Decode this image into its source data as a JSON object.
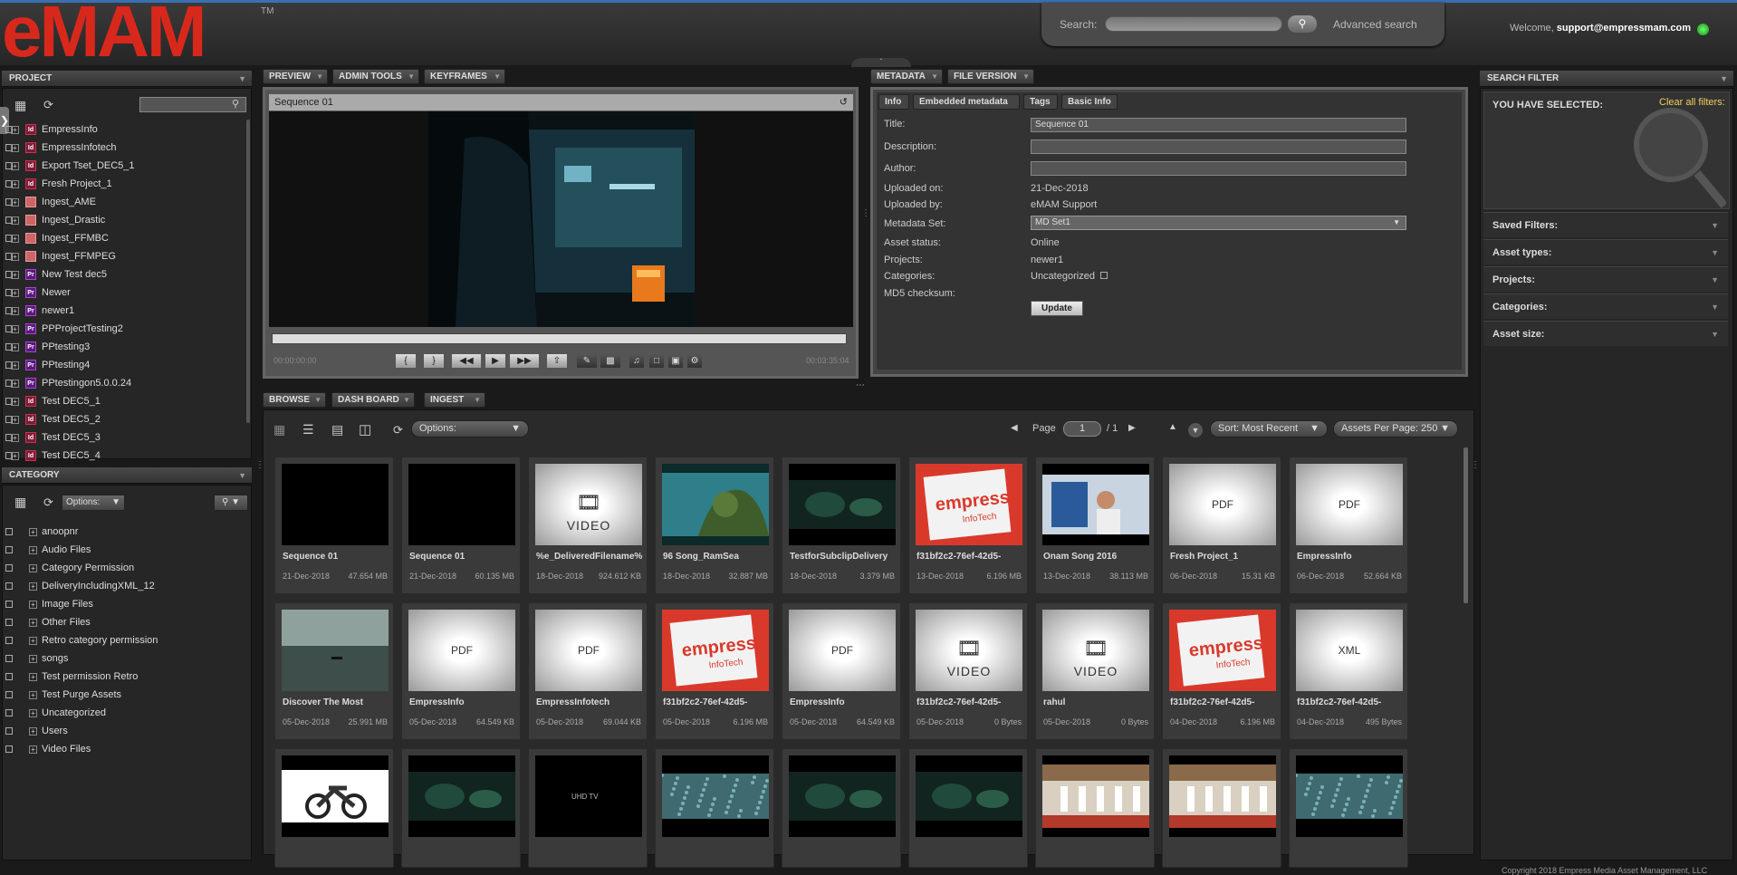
{
  "app": {
    "logo": "eMAM",
    "tm": "TM"
  },
  "header": {
    "search_label": "Search:",
    "search_value": "",
    "advanced": "Advanced search",
    "welcome_prefix": "Welcome,",
    "user": "support@empressmam.com"
  },
  "project_panel": {
    "title": "PROJECT",
    "items": [
      {
        "label": "EmpressInfo",
        "type": "Id"
      },
      {
        "label": "EmpressInfotech",
        "type": "Id"
      },
      {
        "label": "Export Tset_DEC5_1",
        "type": "Id"
      },
      {
        "label": "Fresh Project_1",
        "type": "Id"
      },
      {
        "label": "Ingest_AME",
        "type": "bin"
      },
      {
        "label": "Ingest_Drastic",
        "type": "bin"
      },
      {
        "label": "Ingest_FFMBC",
        "type": "bin"
      },
      {
        "label": "Ingest_FFMPEG",
        "type": "bin"
      },
      {
        "label": "New Test dec5",
        "type": "Pr"
      },
      {
        "label": "Newer",
        "type": "Pr"
      },
      {
        "label": "newer1",
        "type": "Pr"
      },
      {
        "label": "PPProjectTesting2",
        "type": "Pr"
      },
      {
        "label": "PPtesting3",
        "type": "Pr"
      },
      {
        "label": "PPtesting4",
        "type": "Pr"
      },
      {
        "label": "PPtestingon5.0.0.24",
        "type": "Pr"
      },
      {
        "label": "Test DEC5_1",
        "type": "Id"
      },
      {
        "label": "Test DEC5_2",
        "type": "Id"
      },
      {
        "label": "Test DEC5_3",
        "type": "Id"
      },
      {
        "label": "Test DEC5_4",
        "type": "Id"
      }
    ]
  },
  "category_panel": {
    "title": "CATEGORY",
    "options_label": "Options:",
    "items": [
      "anoopnr",
      "Audio Files",
      "Category Permission",
      "DeliveryIncludingXML_12",
      "Image Files",
      "Other Files",
      "Retro category permission",
      "songs",
      "Test permission Retro",
      "Test Purge Assets",
      "Uncategorized",
      "Users",
      "Video Files"
    ]
  },
  "preview_tabs": [
    "PREVIEW",
    "ADMIN TOOLS",
    "KEYFRAMES"
  ],
  "player": {
    "title": "Sequence 01",
    "time_start": "00:00:00:00",
    "time_end": "00:03:35:04"
  },
  "metadata_tabs": [
    "METADATA",
    "FILE VERSION"
  ],
  "meta_subtabs": [
    "Info",
    "Embedded metadata",
    "Tags",
    "Basic Info"
  ],
  "metadata": {
    "title_label": "Title:",
    "title_value": "Sequence 01",
    "desc_label": "Description:",
    "author_label": "Author:",
    "uploaded_on_label": "Uploaded on:",
    "uploaded_on": "21-Dec-2018",
    "uploaded_by_label": "Uploaded by:",
    "uploaded_by": "eMAM Support",
    "metaset_label": "Metadata Set:",
    "metaset": "MD Set1",
    "status_label": "Asset status:",
    "status": "Online",
    "projects_label": "Projects:",
    "projects": "newer1",
    "categories_label": "Categories:",
    "categories": "Uncategorized",
    "md5_label": "MD5 checksum:",
    "update_btn": "Update"
  },
  "search_filter": {
    "title": "SEARCH FILTER",
    "selected": "YOU HAVE SELECTED:",
    "clear": "Clear all filters:",
    "items": [
      "Saved Filters:",
      "Asset types:",
      "Projects:",
      "Categories:",
      "Asset size:"
    ]
  },
  "browse_tabs": [
    "BROWSE",
    "DASH BOARD",
    "INGEST"
  ],
  "browse_toolbar": {
    "options": "Options:",
    "page_label": "Page",
    "page": "1",
    "page_total": "/ 1",
    "sort": "Sort: Most Recent",
    "per_page": "Assets Per Page: 250"
  },
  "assets": [
    {
      "name": "Sequence 01",
      "date": "21-Dec-2018",
      "size": "47.654 MB",
      "thumb": "black"
    },
    {
      "name": "Sequence 01",
      "date": "21-Dec-2018",
      "size": "60.135 MB",
      "thumb": "black"
    },
    {
      "name": "%e_DeliveredFilename%",
      "date": "18-Dec-2018",
      "size": "924.612 KB",
      "thumb": "video"
    },
    {
      "name": "96 Song_RamSea",
      "date": "18-Dec-2018",
      "size": "32.887 MB",
      "thumb": "sea"
    },
    {
      "name": "TestforSubclipDelivery",
      "date": "18-Dec-2018",
      "size": "3.379 MB",
      "thumb": "dark"
    },
    {
      "name": "f31bf2c2-76ef-42d5-",
      "date": "13-Dec-2018",
      "size": "6.196 MB",
      "thumb": "empress"
    },
    {
      "name": "Onam Song 2016",
      "date": "13-Dec-2018",
      "size": "38.113 MB",
      "thumb": "onam"
    },
    {
      "name": "Fresh Project_1",
      "date": "06-Dec-2018",
      "size": "15.31 KB",
      "thumb": "pdf"
    },
    {
      "name": "EmpressInfo",
      "date": "06-Dec-2018",
      "size": "52.664 KB",
      "thumb": "pdf"
    },
    {
      "name": "Discover The Most",
      "date": "05-Dec-2018",
      "size": "25.991 MB",
      "thumb": "lake"
    },
    {
      "name": "EmpressInfo",
      "date": "05-Dec-2018",
      "size": "64.549 KB",
      "thumb": "pdf"
    },
    {
      "name": "EmpressInfotech",
      "date": "05-Dec-2018",
      "size": "69.044 KB",
      "thumb": "pdf"
    },
    {
      "name": "f31bf2c2-76ef-42d5-",
      "date": "05-Dec-2018",
      "size": "6.196 MB",
      "thumb": "empress"
    },
    {
      "name": "EmpressInfo",
      "date": "05-Dec-2018",
      "size": "64.549 KB",
      "thumb": "pdf"
    },
    {
      "name": "f31bf2c2-76ef-42d5-",
      "date": "05-Dec-2018",
      "size": "0 Bytes",
      "thumb": "video"
    },
    {
      "name": "rahul",
      "date": "05-Dec-2018",
      "size": "0 Bytes",
      "thumb": "video"
    },
    {
      "name": "f31bf2c2-76ef-42d5-",
      "date": "04-Dec-2018",
      "size": "6.196 MB",
      "thumb": "empress"
    },
    {
      "name": "f31bf2c2-76ef-42d5-",
      "date": "04-Dec-2018",
      "size": "495 Bytes",
      "thumb": "xml"
    },
    {
      "name": "",
      "date": "",
      "size": "",
      "thumb": "bike"
    },
    {
      "name": "",
      "date": "",
      "size": "",
      "thumb": "dark"
    },
    {
      "name": "",
      "date": "",
      "size": "",
      "thumb": "uhd"
    },
    {
      "name": "",
      "date": "",
      "size": "",
      "thumb": "texture"
    },
    {
      "name": "",
      "date": "",
      "size": "",
      "thumb": "dark"
    },
    {
      "name": "",
      "date": "",
      "size": "",
      "thumb": "dark"
    },
    {
      "name": "",
      "date": "",
      "size": "",
      "thumb": "dance"
    },
    {
      "name": "",
      "date": "",
      "size": "",
      "thumb": "dance"
    },
    {
      "name": "",
      "date": "",
      "size": "",
      "thumb": "texture"
    }
  ],
  "thumb_labels": {
    "video": "VIDEO",
    "pdf": "PDF",
    "xml": "XML",
    "empress": "empress",
    "infotech": "InfoTech",
    "uhd": "UHD TV"
  },
  "footer": "Copyright 2018 Empress Media Asset Management, LLC"
}
